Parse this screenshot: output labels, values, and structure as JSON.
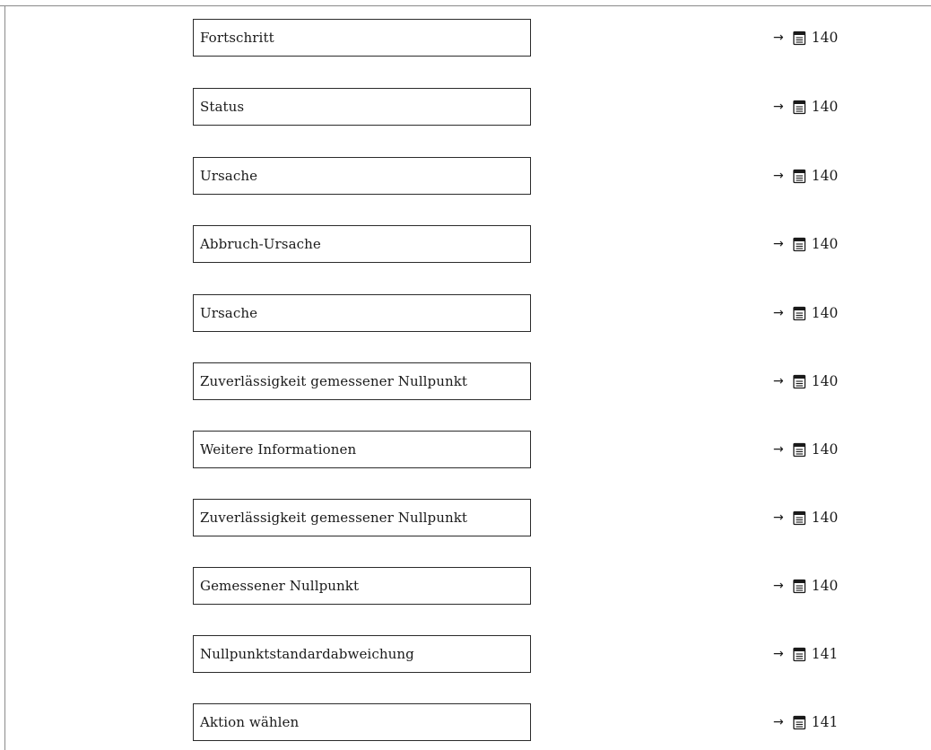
{
  "items": [
    {
      "label": "Fortschritt",
      "ref_arrow": "→",
      "page_icon": "book-page-icon",
      "page": "140"
    },
    {
      "label": "Status",
      "ref_arrow": "→",
      "page_icon": "book-page-icon",
      "page": "140"
    },
    {
      "label": "Ursache",
      "ref_arrow": "→",
      "page_icon": "book-page-icon",
      "page": "140"
    },
    {
      "label": "Abbruch-Ursache",
      "ref_arrow": "→",
      "page_icon": "book-page-icon",
      "page": "140"
    },
    {
      "label": "Ursache",
      "ref_arrow": "→",
      "page_icon": "book-page-icon",
      "page": "140"
    },
    {
      "label": "Zuverlässigkeit gemessener Nullpunkt",
      "ref_arrow": "→",
      "page_icon": "book-page-icon",
      "page": "140"
    },
    {
      "label": "Weitere Informationen",
      "ref_arrow": "→",
      "page_icon": "book-page-icon",
      "page": "140"
    },
    {
      "label": "Zuverlässigkeit gemessener Nullpunkt",
      "ref_arrow": "→",
      "page_icon": "book-page-icon",
      "page": "140"
    },
    {
      "label": "Gemessener Nullpunkt",
      "ref_arrow": "→",
      "page_icon": "book-page-icon",
      "page": "140"
    },
    {
      "label": "Nullpunktstandardabweichung",
      "ref_arrow": "→",
      "page_icon": "book-page-icon",
      "page": "141"
    },
    {
      "label": "Aktion wählen",
      "ref_arrow": "→",
      "page_icon": "book-page-icon",
      "page": "141"
    }
  ],
  "colors": {
    "box_border": "#2b2b2b",
    "frame_line": "#8a8a8a",
    "text": "#1a1a1a"
  }
}
